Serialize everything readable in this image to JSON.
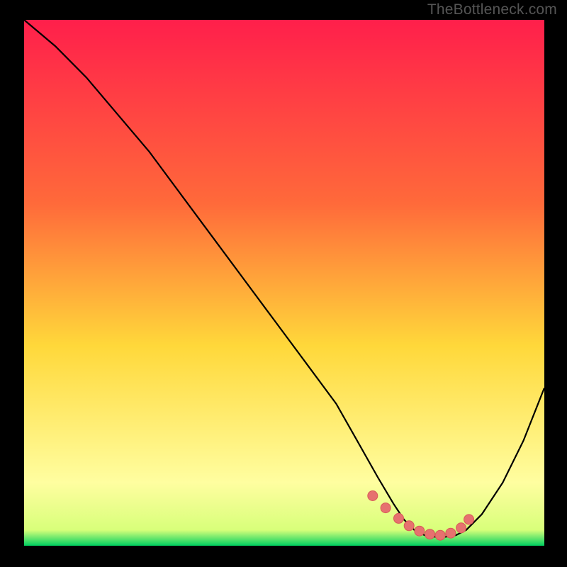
{
  "watermark": "TheBottleneck.com",
  "colors": {
    "frame_bg": "#000000",
    "gradient_top": "#ff1f4b",
    "gradient_upper_mid": "#ff6a3a",
    "gradient_mid": "#ffd83a",
    "gradient_lower_mid": "#fffea0",
    "gradient_bottom": "#00d060",
    "curve": "#000000",
    "marker_fill": "#e6716f",
    "marker_stroke": "#d85a58"
  },
  "chart_data": {
    "type": "line",
    "title": "",
    "xlabel": "",
    "ylabel": "",
    "xlim": [
      0,
      100
    ],
    "ylim": [
      0,
      100
    ],
    "curve": {
      "x": [
        0,
        6,
        12,
        18,
        24,
        30,
        36,
        42,
        48,
        54,
        60,
        64,
        68,
        71,
        73,
        75,
        77,
        79,
        81,
        83,
        85,
        88,
        92,
        96,
        100
      ],
      "y": [
        100,
        95,
        89,
        82,
        75,
        67,
        59,
        51,
        43,
        35,
        27,
        20,
        13,
        8,
        5,
        3,
        2,
        1.7,
        1.7,
        2,
        3,
        6,
        12,
        20,
        30
      ]
    },
    "markers": {
      "x": [
        67,
        69.5,
        72,
        74,
        76,
        78,
        80,
        82,
        84,
        85.5
      ],
      "y": [
        9.5,
        7.2,
        5.2,
        3.8,
        2.8,
        2.2,
        2.0,
        2.4,
        3.4,
        5.0
      ]
    }
  }
}
